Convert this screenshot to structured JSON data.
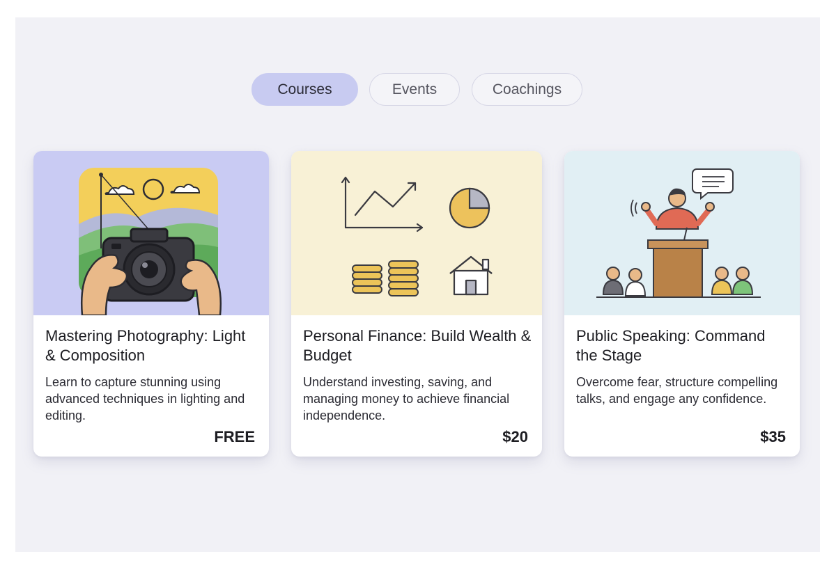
{
  "tabs": [
    {
      "label": "Courses",
      "active": true
    },
    {
      "label": "Events",
      "active": false
    },
    {
      "label": "Coachings",
      "active": false
    }
  ],
  "cards": [
    {
      "title": "Mastering Photography: Light & Composition",
      "description": "Learn to capture stunning using advanced techniques in lighting and editing.",
      "price": "FREE",
      "illustration": "camera-landscape-illustration",
      "accent": "#c9cbf3"
    },
    {
      "title": "Personal Finance: Build Wealth & Budget",
      "description": "Understand investing, saving, and managing money to achieve financial independence.",
      "price": "$20",
      "illustration": "finance-chart-coins-house-illustration",
      "accent": "#f8f1d6"
    },
    {
      "title": "Public Speaking: Command the Stage",
      "description": "Overcome fear, structure compelling talks, and engage any confidence.",
      "price": "$35",
      "illustration": "speaker-podium-audience-illustration",
      "accent": "#e1eff4"
    }
  ]
}
